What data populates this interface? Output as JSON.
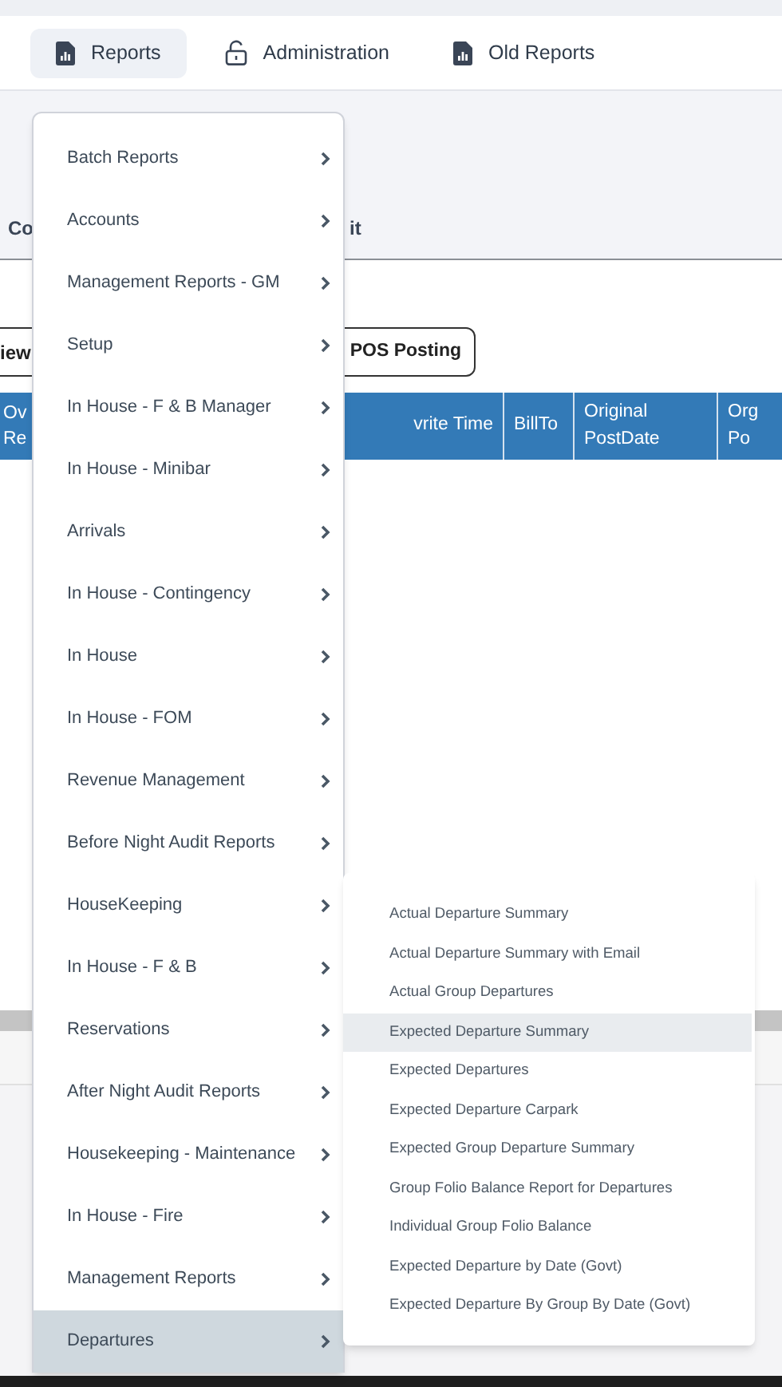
{
  "nav_tabs": [
    {
      "label": "Reports",
      "kind": "report",
      "selected": true
    },
    {
      "label": "Administration",
      "kind": "lock",
      "selected": false
    },
    {
      "label": "Old Reports",
      "kind": "report",
      "selected": false
    }
  ],
  "page_tabs": [
    "Co",
    "it"
  ],
  "view_button": "iew",
  "pos_button": "POS Posting",
  "table_columns": [
    "Ov Re",
    "vrite Time",
    "BillTo",
    "Original PostDate",
    "Org Po"
  ],
  "menu": [
    {
      "label": "Batch Reports",
      "selected": false
    },
    {
      "label": "Accounts",
      "selected": false
    },
    {
      "label": "Management Reports - GM",
      "selected": false
    },
    {
      "label": "Setup",
      "selected": false
    },
    {
      "label": "In House - F & B Manager",
      "selected": false
    },
    {
      "label": "In House - Minibar",
      "selected": false
    },
    {
      "label": "Arrivals",
      "selected": false
    },
    {
      "label": "In House - Contingency",
      "selected": false
    },
    {
      "label": "In House",
      "selected": false
    },
    {
      "label": "In House - FOM",
      "selected": false
    },
    {
      "label": "Revenue Management",
      "selected": false
    },
    {
      "label": "Before Night Audit Reports",
      "selected": false
    },
    {
      "label": "HouseKeeping",
      "selected": false
    },
    {
      "label": "In House - F & B",
      "selected": false
    },
    {
      "label": "Reservations",
      "selected": false
    },
    {
      "label": "After Night Audit Reports",
      "selected": false
    },
    {
      "label": "Housekeeping - Maintenance",
      "selected": false
    },
    {
      "label": "In House - Fire",
      "selected": false
    },
    {
      "label": "Management Reports",
      "selected": false
    },
    {
      "label": "Departures",
      "selected": true
    }
  ],
  "submenu": [
    {
      "label": "Actual Departure Summary",
      "selected": false
    },
    {
      "label": "Actual Departure Summary with Email",
      "selected": false
    },
    {
      "label": "Actual Group Departures",
      "selected": false
    },
    {
      "label": "Expected Departure Summary",
      "selected": true
    },
    {
      "label": "Expected Departures",
      "selected": false
    },
    {
      "label": "Expected Departure Carpark",
      "selected": false
    },
    {
      "label": "Expected Group Departure Summary",
      "selected": false
    },
    {
      "label": "Group Folio Balance Report for Departures",
      "selected": false
    },
    {
      "label": "Individual Group Folio Balance",
      "selected": false
    },
    {
      "label": "Expected Departure by Date (Govt)",
      "selected": false
    },
    {
      "label": "Expected Departure By Group By Date (Govt)",
      "selected": false
    }
  ]
}
